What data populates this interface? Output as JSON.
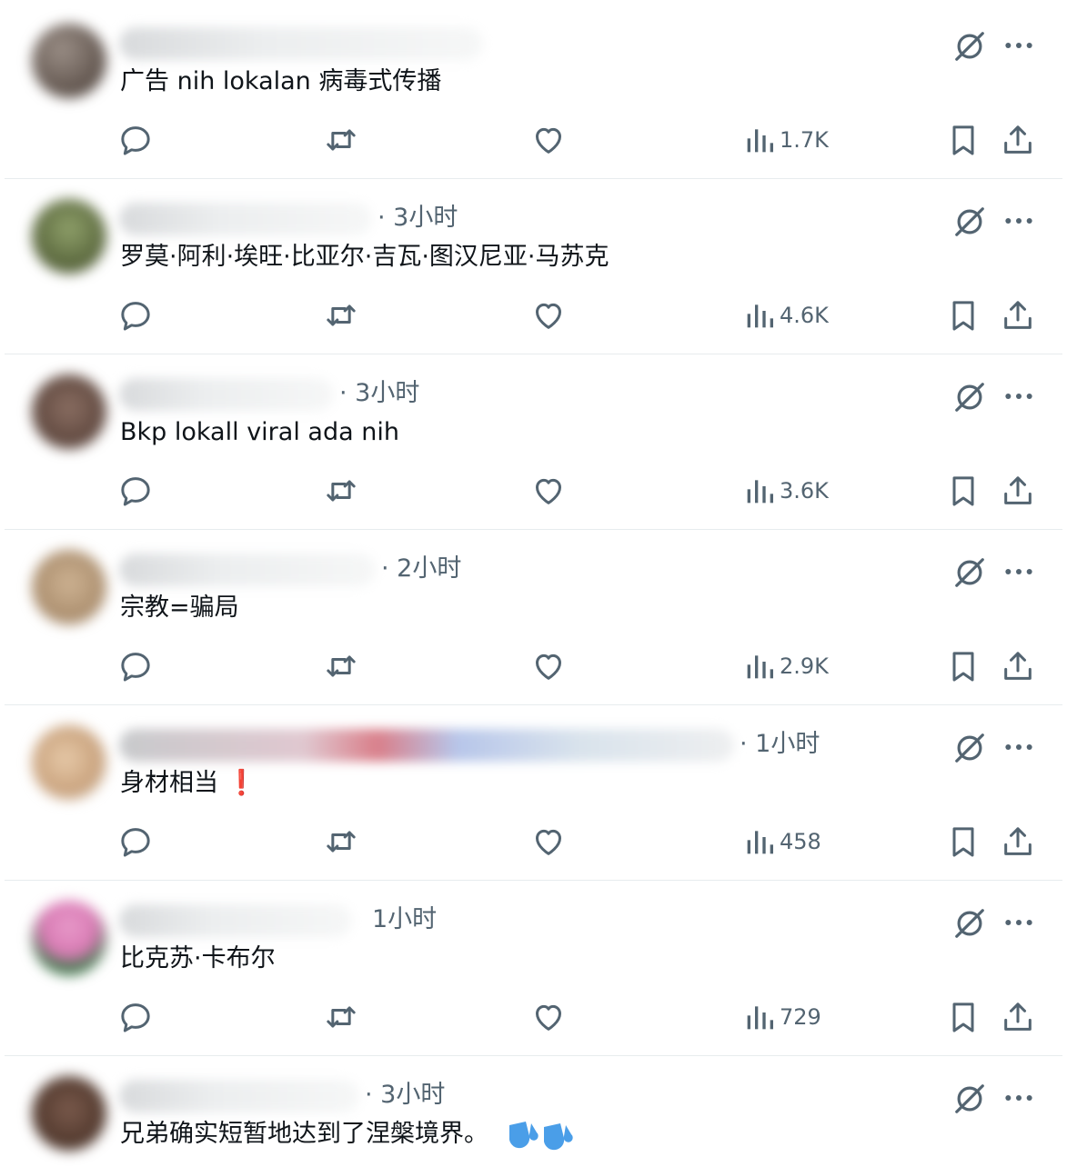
{
  "posts": [
    {
      "time": "",
      "text": "广告 nih lokalan 病毒式传播",
      "views": "1.7K"
    },
    {
      "time": "· 3小时",
      "text": "罗莫·阿利·埃旺·比亚尔·吉瓦·图汉尼亚·马苏克",
      "views": "4.6K"
    },
    {
      "time": "· 3小时",
      "text": "Bkp lokall viral ada nih",
      "views": "3.6K"
    },
    {
      "time": "· 2小时",
      "text": "宗教=骗局",
      "views": "2.9K"
    },
    {
      "time": "· 1小时",
      "text": "身材相当",
      "emoji": "❗",
      "views": "458"
    },
    {
      "time": "1小时",
      "text": "比克苏·卡布尔",
      "views": "729"
    },
    {
      "time": "· 3小时",
      "text": "兄弟确实短暂地达到了涅槃境界。",
      "views": ""
    }
  ],
  "colors": {
    "icon": "#536471",
    "text": "#0f1419",
    "divider": "#eff3f4",
    "alert_emoji": "#d81e2c",
    "sweat_emoji": "#4a9ee8"
  },
  "icons": [
    "reply-icon",
    "retweet-icon",
    "like-icon",
    "views-icon",
    "bookmark-icon",
    "share-icon",
    "grok-icon",
    "more-icon"
  ]
}
